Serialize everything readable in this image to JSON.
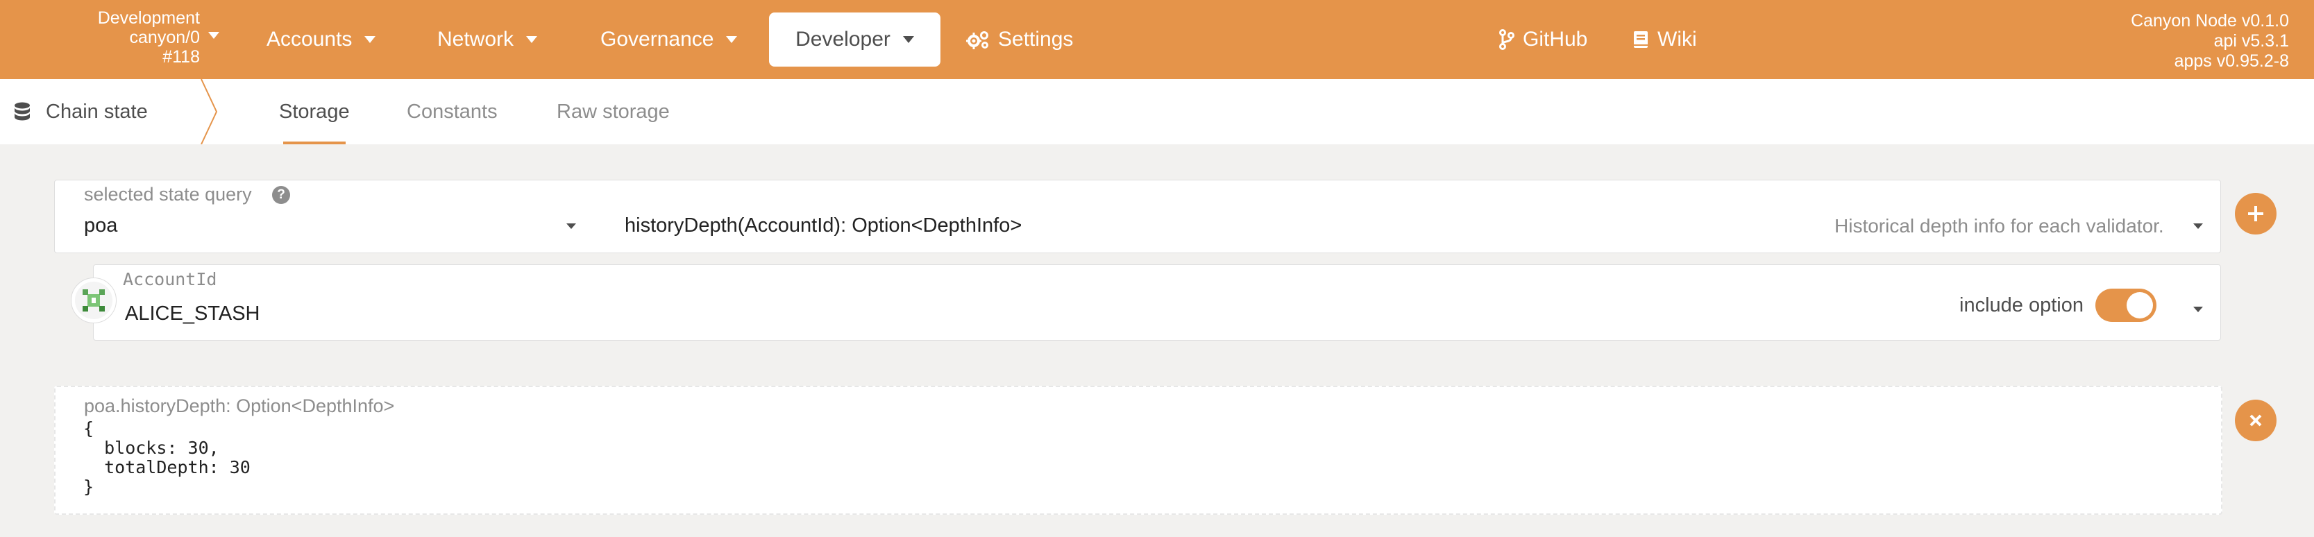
{
  "colors": {
    "accent": "#e5944a",
    "page_bg": "#f2f1ef"
  },
  "topbar": {
    "chain": {
      "name": "Development",
      "spec": "canyon/0",
      "block": "#118"
    },
    "nav": [
      {
        "label": "Accounts",
        "icon": "none"
      },
      {
        "label": "Network",
        "icon": "none"
      },
      {
        "label": "Governance",
        "icon": "none"
      },
      {
        "label": "Developer",
        "icon": "none",
        "active": true
      },
      {
        "label": "Settings",
        "icon": "gears-icon"
      }
    ],
    "links": [
      {
        "label": "GitHub",
        "icon": "code-branch-icon"
      },
      {
        "label": "Wiki",
        "icon": "book-icon"
      }
    ],
    "node": {
      "name": "Canyon Node v0.1.0",
      "api": "api v5.3.1",
      "apps": "apps v0.95.2-8"
    }
  },
  "subnav": {
    "title": "Chain state",
    "tabs": [
      "Storage",
      "Constants",
      "Raw storage"
    ],
    "active_tab": "Storage"
  },
  "query": {
    "label": "selected state query",
    "module": "poa",
    "method": "historyDepth(AccountId): Option<DepthInfo>",
    "method_doc": "Historical depth info for each validator.",
    "param_label": "AccountId",
    "param_value": "ALICE_STASH",
    "include_option_label": "include option",
    "include_option": true
  },
  "result": {
    "title": "poa.historyDepth: Option<DepthInfo>",
    "lines": [
      "{",
      "  blocks: 30,",
      "  totalDepth: 30",
      "}"
    ]
  }
}
